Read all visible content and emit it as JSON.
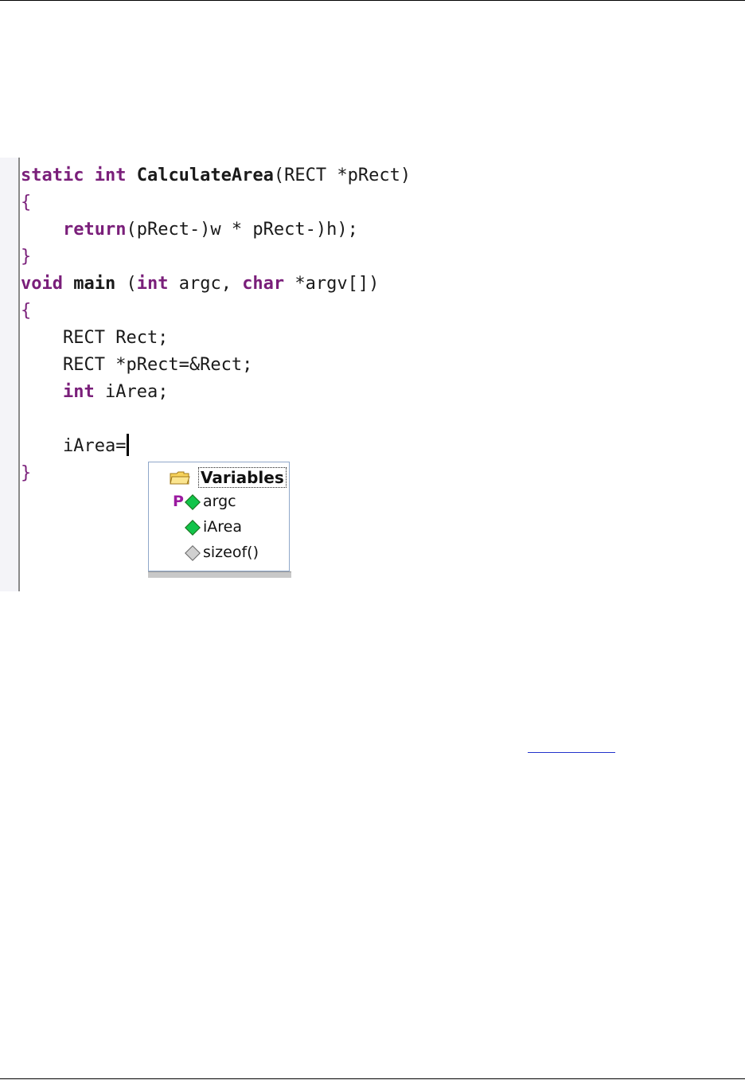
{
  "code_lines": [
    [
      {
        "t": "static int ",
        "k": "kw"
      },
      {
        "t": "CalculateArea",
        "k": "bold"
      },
      {
        "t": "(RECT *pRect)",
        "k": "plain"
      }
    ],
    [
      {
        "t": "{",
        "k": "br"
      }
    ],
    [
      {
        "t": "    ",
        "k": "plain"
      },
      {
        "t": "return",
        "k": "kw"
      },
      {
        "t": "(pRect-)w * pRect-)h);",
        "k": "plain"
      }
    ],
    [
      {
        "t": "}",
        "k": "br"
      }
    ],
    [
      {
        "t": "void ",
        "k": "kw"
      },
      {
        "t": "main",
        "k": "bold"
      },
      {
        "t": " (",
        "k": "plain"
      },
      {
        "t": "int",
        "k": "kw"
      },
      {
        "t": " argc, ",
        "k": "plain"
      },
      {
        "t": "char",
        "k": "kw"
      },
      {
        "t": " *argv[])",
        "k": "plain"
      }
    ],
    [
      {
        "t": "{",
        "k": "br"
      }
    ],
    [
      {
        "t": "    RECT Rect;",
        "k": "plain"
      }
    ],
    [
      {
        "t": "    RECT *pRect=&Rect;",
        "k": "plain"
      }
    ],
    [
      {
        "t": "    ",
        "k": "plain"
      },
      {
        "t": "int",
        "k": "kw"
      },
      {
        "t": " iArea;",
        "k": "plain"
      }
    ],
    [
      {
        "t": "",
        "k": "plain"
      }
    ],
    [
      {
        "t": "    iArea=",
        "k": "plain"
      }
    ],
    [
      {
        "t": "}",
        "k": "br"
      }
    ]
  ],
  "autocomplete": {
    "header": "Variables",
    "items": [
      {
        "label": "argc",
        "badge": "P",
        "icon": "green-diamond-icon"
      },
      {
        "label": "iArea",
        "icon": "green-diamond-icon"
      },
      {
        "label": "sizeof()",
        "icon": "gray-diamond-icon"
      }
    ]
  },
  "colors": {
    "keyword": "#7a1f7a",
    "parameter_badge": "#9b1aa0",
    "variable_icon": "#12c44a"
  }
}
